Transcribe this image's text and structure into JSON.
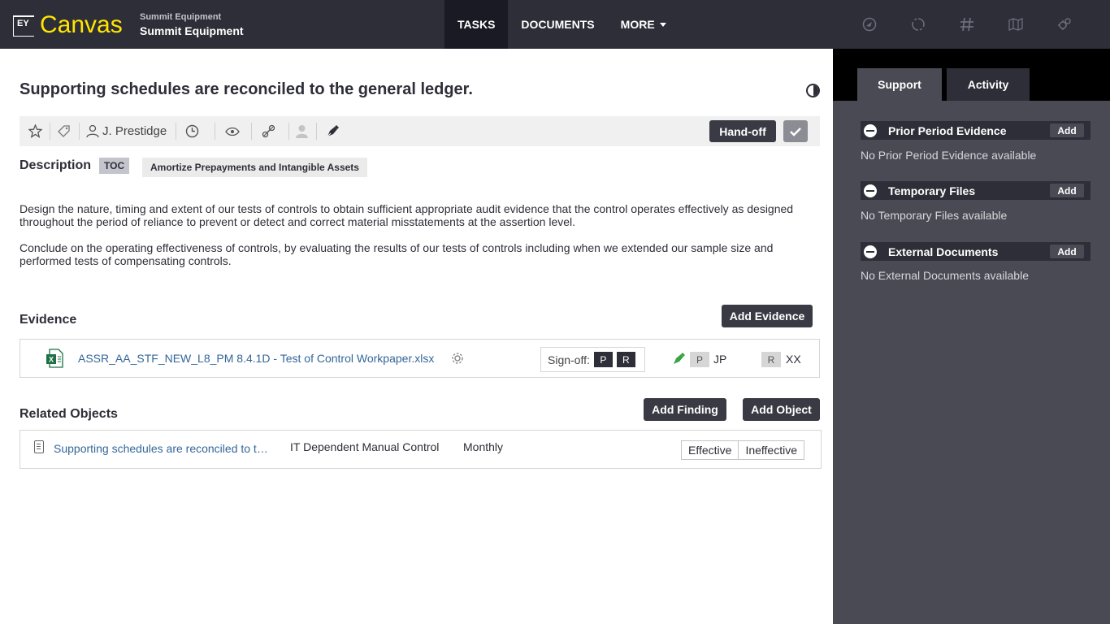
{
  "header": {
    "brand": "Canvas",
    "logo_text": "EY",
    "client_sub": "Summit Equipment",
    "client_main": "Summit Equipment",
    "nav": [
      {
        "label": "TASKS",
        "active": true
      },
      {
        "label": "DOCUMENTS",
        "active": false
      },
      {
        "label": "MORE",
        "active": false
      }
    ],
    "icons": [
      "compass-icon",
      "sync-icon",
      "hash-icon",
      "map-icon",
      "gears-icon"
    ]
  },
  "task": {
    "title": "Supporting schedules are reconciled to the general ledger.",
    "assignee": "J. Prestidge",
    "handoff_label": "Hand-off"
  },
  "description": {
    "label": "Description",
    "tag": "TOC",
    "assertion": "Amortize Prepayments and Intangible Assets",
    "paragraphs": [
      "Design the nature, timing and extent of our tests of controls to obtain sufficient appropriate audit evidence that the control operates effectively as designed throughout the period of reliance to prevent or detect and correct material misstatements at the assertion level.",
      "Conclude on the operating effectiveness of controls, by evaluating the results of our tests of controls including when we extended our sample size and performed tests of compensating controls."
    ]
  },
  "evidence": {
    "title": "Evidence",
    "add_label": "Add Evidence",
    "file": "ASSR_AA_STF_NEW_L8_PM 8.4.1D - Test of Control Workpaper.xlsx",
    "signoff_label": "Sign-off:",
    "signoff_p": "P",
    "signoff_r": "R",
    "preparer_chip": "P",
    "preparer_initials": "JP",
    "reviewer_chip": "R",
    "reviewer_initials": "XX"
  },
  "related": {
    "title": "Related Objects",
    "add_finding": "Add Finding",
    "add_object": "Add Object",
    "link": "Supporting schedules are reconciled to the general ledger.",
    "type": "IT Dependent Manual Control",
    "frequency": "Monthly",
    "effective": "Effective",
    "ineffective": "Ineffective"
  },
  "right_panel": {
    "tabs": [
      {
        "label": "Support",
        "active": true
      },
      {
        "label": "Activity",
        "active": false
      }
    ],
    "add_label": "Add",
    "sections": [
      {
        "title": "Prior Period Evidence",
        "empty": "No Prior Period Evidence available"
      },
      {
        "title": "Temporary Files",
        "empty": "No Temporary Files available"
      },
      {
        "title": "External Documents",
        "empty": "No External Documents available"
      }
    ]
  },
  "colors": {
    "brand_yellow": "#ffe600",
    "dark": "#2e2e38",
    "link": "#336699",
    "excel_green": "#1d7044"
  }
}
